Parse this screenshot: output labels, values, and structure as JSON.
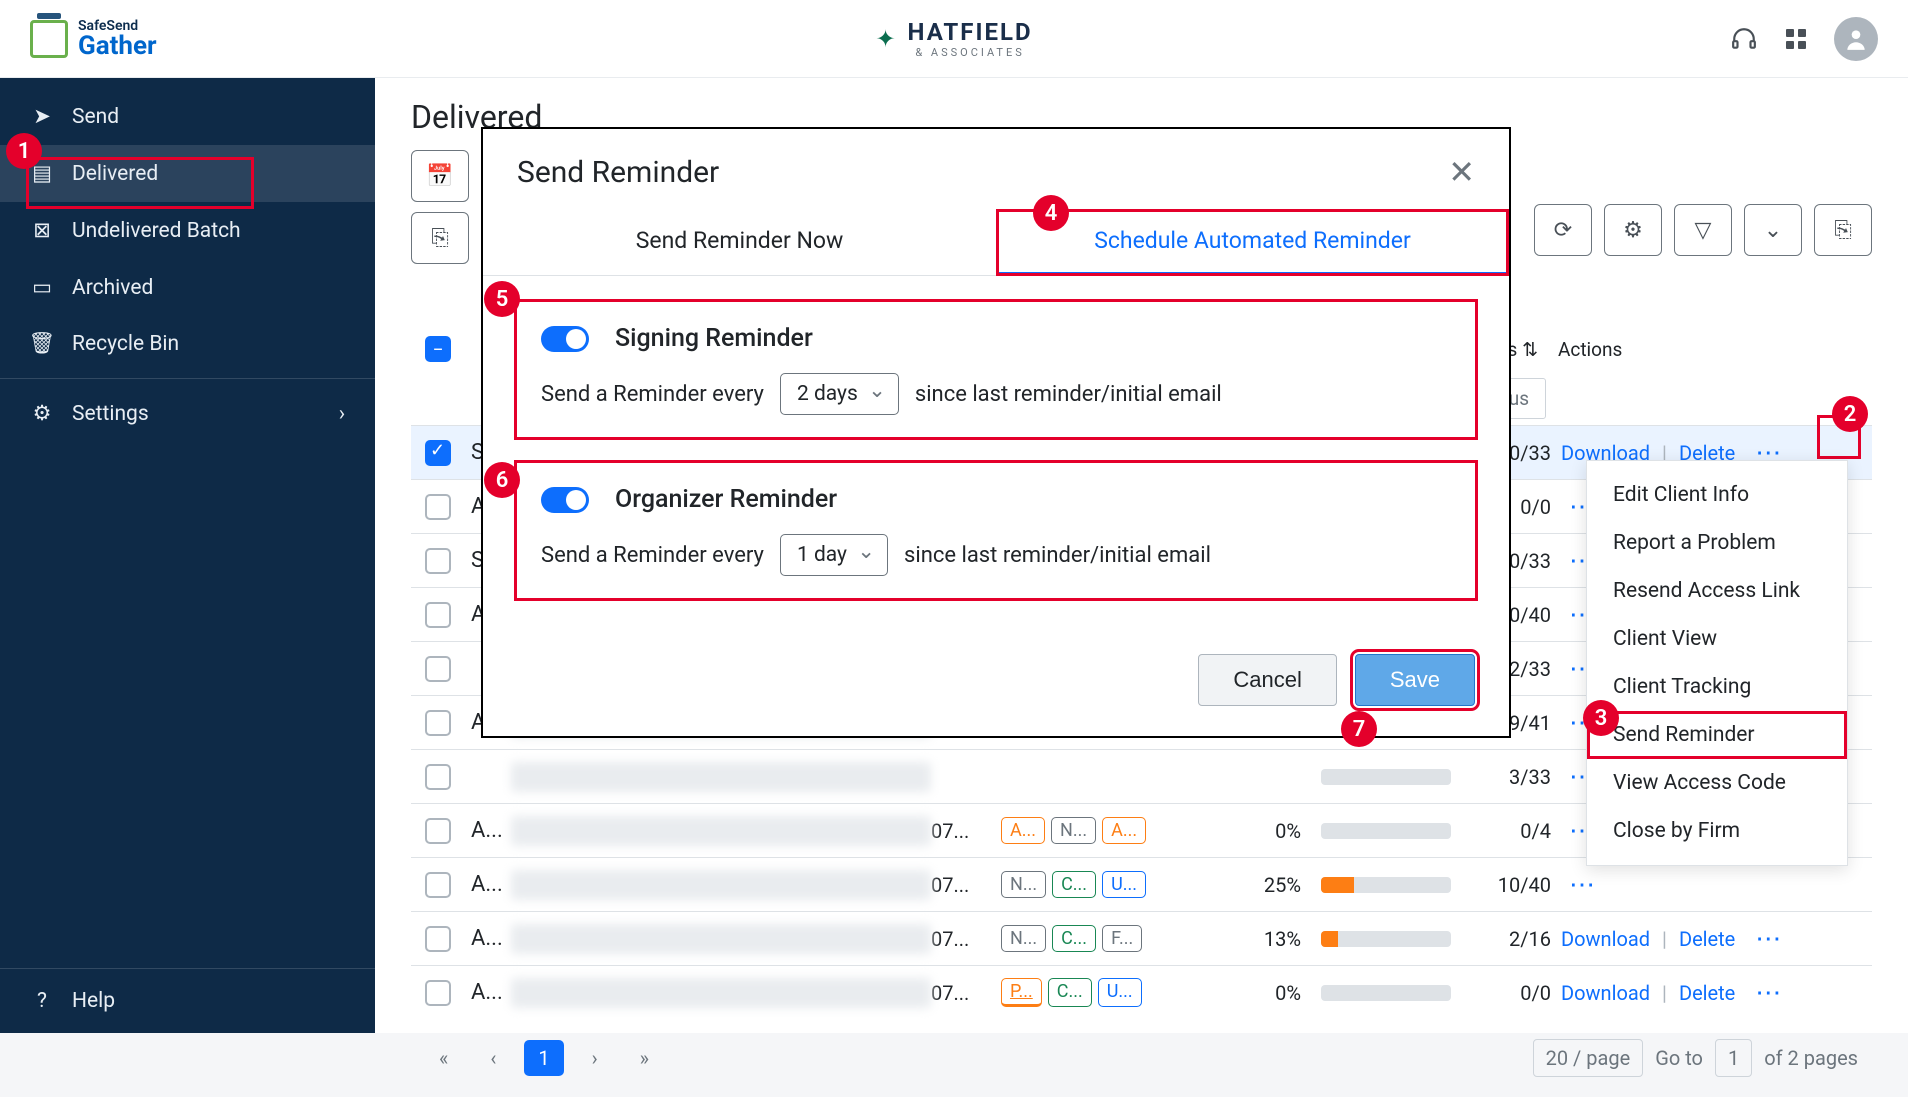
{
  "header": {
    "product_line1": "SafeSend",
    "product_line2": "Gather",
    "brand_name": "HATFIELD",
    "brand_sub": "& ASSOCIATES"
  },
  "sidebar": {
    "items": [
      {
        "label": "Send"
      },
      {
        "label": "Delivered"
      },
      {
        "label": "Undelivered Batch"
      },
      {
        "label": "Archived"
      },
      {
        "label": "Recycle Bin"
      },
      {
        "label": "Settings"
      }
    ],
    "help": "Help"
  },
  "page": {
    "title": "Delivered",
    "col_documents": "Documents",
    "col_actions": "Actions",
    "status_placeholder": "Status"
  },
  "rows": [
    {
      "name": "S",
      "date": "",
      "badges": [],
      "pct": "",
      "docs": "0/33",
      "dl": "Download",
      "del": "Delete",
      "first": true,
      "checked": true
    },
    {
      "name": "A",
      "date": "",
      "badges": [],
      "pct": "",
      "docs": "0/0"
    },
    {
      "name": "S",
      "date": "",
      "badges": [],
      "pct": "",
      "docs": "0/33"
    },
    {
      "name": "A",
      "date": "",
      "badges": [],
      "pct": "",
      "docs": "0/40"
    },
    {
      "name": "",
      "date": "",
      "badges": [],
      "pct": "",
      "docs": "2/33"
    },
    {
      "name": "A",
      "date": "",
      "badges": [],
      "pct": "",
      "docs": "9/41"
    },
    {
      "name": "",
      "date": "",
      "badges": [],
      "pct": "",
      "docs": "3/33"
    },
    {
      "name": "A...",
      "date": "07...",
      "badges": [
        "A...",
        "N...",
        "A..."
      ],
      "bcls": [
        "b-o",
        "b-g",
        "b-o"
      ],
      "pct": "0%",
      "fill": 0,
      "docs": "0/4"
    },
    {
      "name": "A...",
      "date": "07...",
      "badges": [
        "N...",
        "C...",
        "U..."
      ],
      "bcls": [
        "b-g",
        "b-gr",
        "b-b"
      ],
      "pct": "25%",
      "fill": 25,
      "docs": "10/40"
    },
    {
      "name": "A...",
      "date": "07...",
      "badges": [
        "N...",
        "C...",
        "F..."
      ],
      "bcls": [
        "b-g",
        "b-gr",
        "b-g"
      ],
      "pct": "13%",
      "fill": 13,
      "docs": "2/16",
      "dl": "Download",
      "del": "Delete"
    },
    {
      "name": "A...",
      "date": "07...",
      "badges": [
        "P...",
        "C...",
        "U..."
      ],
      "bcls": [
        "b-o b-u",
        "b-gr",
        "b-b"
      ],
      "pct": "0%",
      "fill": 0,
      "docs": "0/0",
      "dl": "Download",
      "del": "Delete"
    }
  ],
  "pager": {
    "page": "1",
    "per_page": "20 / page",
    "goto": "Go to",
    "goto_val": "1",
    "of": "of 2  pages"
  },
  "modal": {
    "title": "Send Reminder",
    "tab1": "Send Reminder Now",
    "tab2": "Schedule Automated Reminder",
    "sec1_title": "Signing Reminder",
    "sec2_title": "Organizer Reminder",
    "label_pre": "Send a Reminder every",
    "label_post": "since last reminder/initial email",
    "dd1": "2 days",
    "dd2": "1 day",
    "cancel": "Cancel",
    "save": "Save"
  },
  "ctx": {
    "items": [
      "Edit Client Info",
      "Report a Problem",
      "Resend Access Link",
      "Client View",
      "Client Tracking",
      "Send Reminder",
      "View Access Code",
      "Close by Firm"
    ]
  },
  "callouts": {
    "1": "1",
    "2": "2",
    "3": "3",
    "4": "4",
    "5": "5",
    "6": "6",
    "7": "7"
  }
}
